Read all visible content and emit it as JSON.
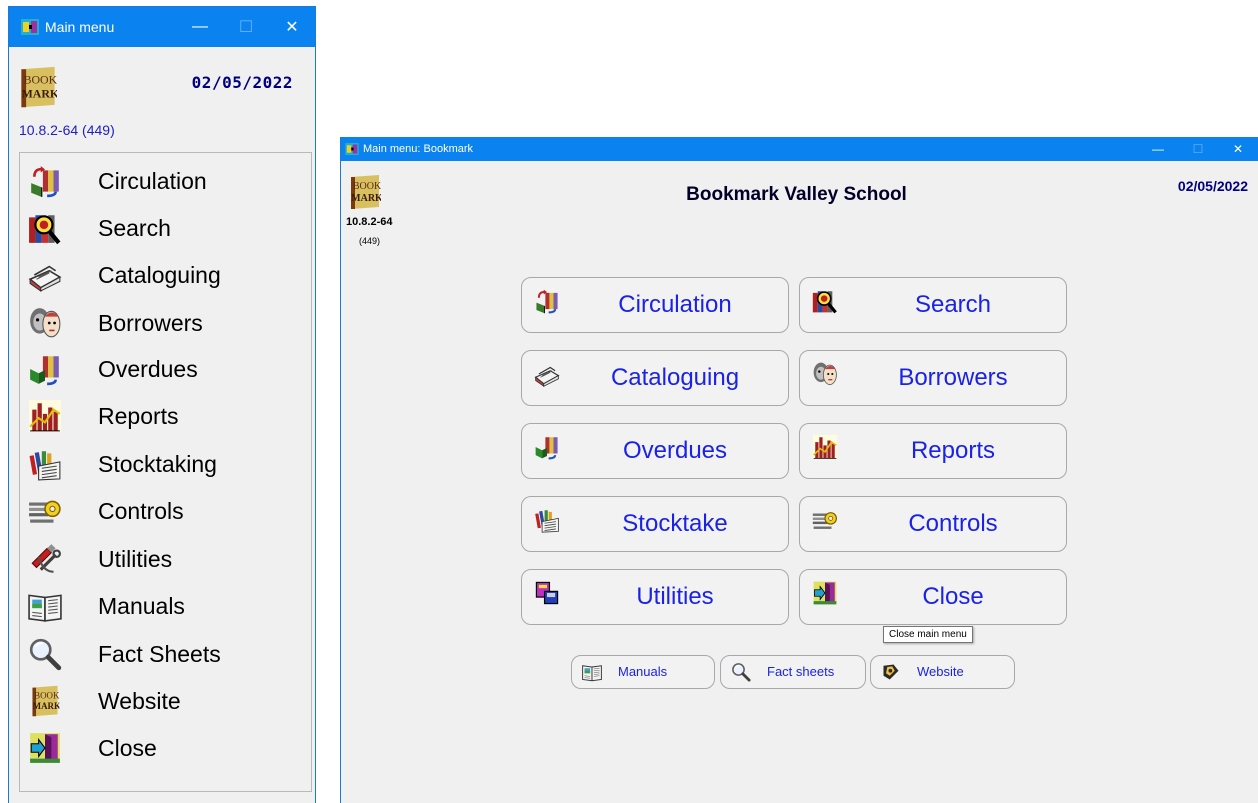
{
  "small_window": {
    "title": "Main menu",
    "date": "02/05/2022",
    "version": "10.8.2-64 (449)",
    "logo_text_1": "BOOK",
    "logo_text_2": "MARK",
    "items": [
      {
        "label": "Circulation",
        "icon": "circulation-icon"
      },
      {
        "label": "Search",
        "icon": "search-icon"
      },
      {
        "label": "Cataloguing",
        "icon": "cataloguing-icon"
      },
      {
        "label": "Borrowers",
        "icon": "borrowers-icon"
      },
      {
        "label": "Overdues",
        "icon": "overdues-icon"
      },
      {
        "label": "Reports",
        "icon": "reports-icon"
      },
      {
        "label": "Stocktaking",
        "icon": "stocktaking-icon"
      },
      {
        "label": "Controls",
        "icon": "controls-icon"
      },
      {
        "label": "Utilities",
        "icon": "utilities-icon"
      },
      {
        "label": "Manuals",
        "icon": "manuals-icon"
      },
      {
        "label": "Fact Sheets",
        "icon": "magnifier-icon"
      },
      {
        "label": "Website",
        "icon": "bookmark-logo-icon"
      },
      {
        "label": "Close",
        "icon": "exit-door-icon"
      }
    ]
  },
  "big_window": {
    "title": "Main menu: Bookmark",
    "school_name": "Bookmark Valley School",
    "date": "02/05/2022",
    "version": "10.8.2-64",
    "build": "(449)",
    "buttons": [
      {
        "label": "Circulation",
        "icon": "circulation-icon"
      },
      {
        "label": "Search",
        "icon": "search-icon"
      },
      {
        "label": "Cataloguing",
        "icon": "cataloguing-icon"
      },
      {
        "label": "Borrowers",
        "icon": "borrowers-icon"
      },
      {
        "label": "Overdues",
        "icon": "overdues-icon"
      },
      {
        "label": "Reports",
        "icon": "reports-icon"
      },
      {
        "label": "Stocktake",
        "icon": "stocktaking-icon"
      },
      {
        "label": "Controls",
        "icon": "controls-icon"
      },
      {
        "label": "Utilities",
        "icon": "utilities-icon"
      },
      {
        "label": "Close",
        "icon": "exit-door-icon"
      }
    ],
    "small_buttons": [
      {
        "label": "Manuals",
        "icon": "manuals-icon"
      },
      {
        "label": "Fact sheets",
        "icon": "magnifier-icon"
      },
      {
        "label": "Website",
        "icon": "website-icon"
      }
    ],
    "tooltip": "Close main menu"
  },
  "colors": {
    "titlebar": "#0a83f0",
    "label_blue": "#1a22e6",
    "date_navy": "#000080"
  }
}
